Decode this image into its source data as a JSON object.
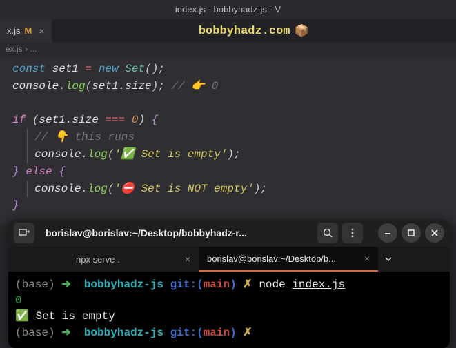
{
  "window": {
    "title": "index.js - bobbyhadz-js - V"
  },
  "tab": {
    "name": "x.js",
    "modified_marker": "M"
  },
  "brand": {
    "text": "bobbyhadz.com",
    "emoji": "📦"
  },
  "breadcrumb": {
    "text": "ex.js › ..."
  },
  "code": {
    "l1": {
      "kw": "const",
      "v": "set1",
      "eq": "=",
      "new": "new",
      "type": "Set",
      "p": "();"
    },
    "l2": {
      "a": "console.",
      "fn": "log",
      "p1": "(",
      "v": "set1",
      "dot": ".",
      "prop": "size",
      "p2": ");",
      "cm": "// 👉️ 0"
    },
    "l3": {
      "kw": "if",
      "p1": "(",
      "v": "set1",
      "dot": ".",
      "prop": "size",
      "op": "===",
      "num": "0",
      "p2": ")",
      "br": "{"
    },
    "l4": {
      "cm": "// 👇️ this runs"
    },
    "l5": {
      "a": "console.",
      "fn": "log",
      "p1": "(",
      "s": "'✅ Set is empty'",
      "p2": ");"
    },
    "l6": {
      "br1": "}",
      "kw": "else",
      "br2": "{"
    },
    "l7": {
      "a": "console.",
      "fn": "log",
      "p1": "(",
      "s": "'⛔ Set is NOT empty'",
      "p2": ");"
    },
    "l8": {
      "br": "}"
    }
  },
  "terminal": {
    "title": "borislav@borislav:~/Desktop/bobbyhadz-r...",
    "tabs": {
      "t1": "npx serve .",
      "t2": "borislav@borislav:~/Desktop/b..."
    },
    "p1": {
      "base": "(base)",
      "arrow": "➜",
      "dir": "bobbyhadz-js",
      "git": "git:(",
      "branch": "main",
      "gitc": ")",
      "x": "✗",
      "cmd": "node",
      "file": "index.js"
    },
    "out1": "0",
    "out2": "✅ Set is empty",
    "p2": {
      "base": "(base)",
      "arrow": "➜",
      "dir": "bobbyhadz-js",
      "git": "git:(",
      "branch": "main",
      "gitc": ")",
      "x": "✗"
    }
  }
}
